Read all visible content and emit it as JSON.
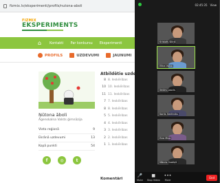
{
  "browser": {
    "url": "fizmix.lv/eksperimenti/profils/nutona-aboli",
    "logo_top": "FIZMIX",
    "logo_main": "EKSPERIMENTS",
    "nav": [
      "Kontakti",
      "Par konkursu",
      "Eksperimenti"
    ],
    "tabs": [
      {
        "label": "PROFILS"
      },
      {
        "label": "UZDEVUMI"
      },
      {
        "label": "JAUNUMI"
      }
    ]
  },
  "profile": {
    "name": "Ņūtona āboli",
    "school": "Āgenskalna Valsts ģimnāzija",
    "rows": [
      {
        "label": "Vieta reģionā",
        "value": "9"
      },
      {
        "label": "Ekrānā uzdevumi",
        "value": "13"
      },
      {
        "label": "Kopā punkti",
        "value": "54"
      }
    ],
    "socials": [
      "f",
      "◎",
      "t"
    ]
  },
  "tasks": {
    "title": "Atbildētie uzdevumi",
    "rows": [
      {
        "n": "8",
        "t": "8. Ieskēribas"
      },
      {
        "n": "10",
        "t": "10. Ieskēribas"
      },
      {
        "n": "11",
        "t": "11. Ieskēribas"
      },
      {
        "n": "7",
        "t": "7. Ieskēribas"
      },
      {
        "n": "8",
        "t": "8. Ieskēribas"
      },
      {
        "n": "5",
        "t": "5. Ieskēribas"
      },
      {
        "n": "4",
        "t": "4. Ieskēribas"
      },
      {
        "n": "3",
        "t": "3. Ieskēribas"
      },
      {
        "n": "2",
        "t": "2. Ieskēribas"
      },
      {
        "n": "1",
        "t": "1. Ieskēribas"
      }
    ],
    "comments": "Komentāri"
  },
  "zoom": {
    "time": "02:45:35",
    "view": "View",
    "participants": [
      {
        "name": "Kristofs Siliņš",
        "shirt": "#3a3a3a"
      },
      {
        "name": "Elīna Vaisa",
        "shirt": "#6b9bd1",
        "active": true
      },
      {
        "name": "Ilmārs Laucis",
        "shirt": "#222"
      },
      {
        "name": "Karlis Smiltniks",
        "shirt": "#4a4a6a"
      },
      {
        "name": "Elza Miza",
        "shirt": "#7a5c8a"
      },
      {
        "name": "Mārcis Ozoliņš",
        "shirt": "#2a2a2a"
      }
    ],
    "toolbar": {
      "mute": "Mute",
      "video": "Stop Video",
      "more": "More",
      "end": "End"
    }
  }
}
